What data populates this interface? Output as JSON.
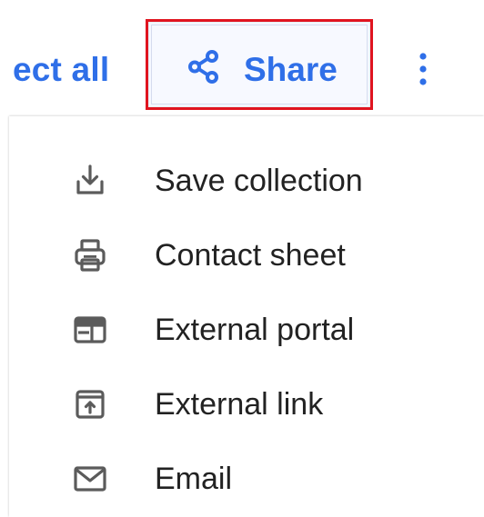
{
  "toolbar": {
    "select_all_text": "ect all",
    "share_label": "Share",
    "share_icon": "share-icon",
    "more_icon": "more-vertical-icon",
    "accent_color": "#2f6fe8",
    "highlight_border_color": "#e0141f"
  },
  "menu": {
    "items": [
      {
        "label": "Save collection",
        "icon": "download-icon"
      },
      {
        "label": "Contact sheet",
        "icon": "printer-icon"
      },
      {
        "label": "External portal",
        "icon": "portal-icon"
      },
      {
        "label": "External link",
        "icon": "external-link-icon"
      },
      {
        "label": "Email",
        "icon": "email-icon"
      }
    ],
    "icon_color": "#5b5b5b",
    "text_color": "#222222"
  }
}
